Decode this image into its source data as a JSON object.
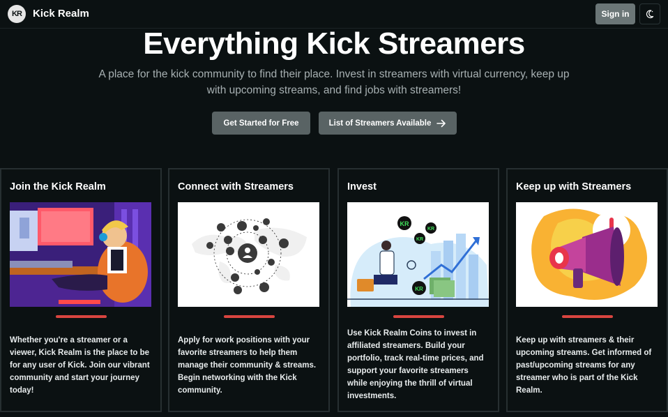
{
  "header": {
    "logo_text": "KR",
    "brand": "Kick Realm",
    "sign_in": "Sign in",
    "theme_icon": "moon-icon"
  },
  "hero": {
    "title": "Everything Kick Streamers",
    "subtitle": "A place for the kick community to find their place. Invest in streamers with virtual currency, keep up with upcoming streams, and find jobs with streamers!",
    "primary_button": "Get Started for Free",
    "secondary_button": "List of Streamers Available"
  },
  "cards": [
    {
      "title": "Join the Kick Realm",
      "text": "Whether you're a streamer or a viewer, Kick Realm is the place to be for any user of Kick. Join our vibrant community and start your journey today!"
    },
    {
      "title": "Connect with Streamers",
      "text": "Apply for work positions with your favorite streamers to help them manage their community & streams. Begin networking with the Kick community."
    },
    {
      "title": "Invest",
      "text": "Use Kick Realm Coins to invest in affiliated streamers. Build your portfolio, track real-time prices, and support your favorite streamers while enjoying the thrill of virtual investments."
    },
    {
      "title": "Keep up with Streamers",
      "text": "Keep up with streamers & their upcoming streams. Get informed of past/upcoming streams for any streamer who is part of the Kick Realm."
    }
  ],
  "colors": {
    "background": "#0b1112",
    "button": "#596364",
    "accent_bar": "#d9453f"
  }
}
